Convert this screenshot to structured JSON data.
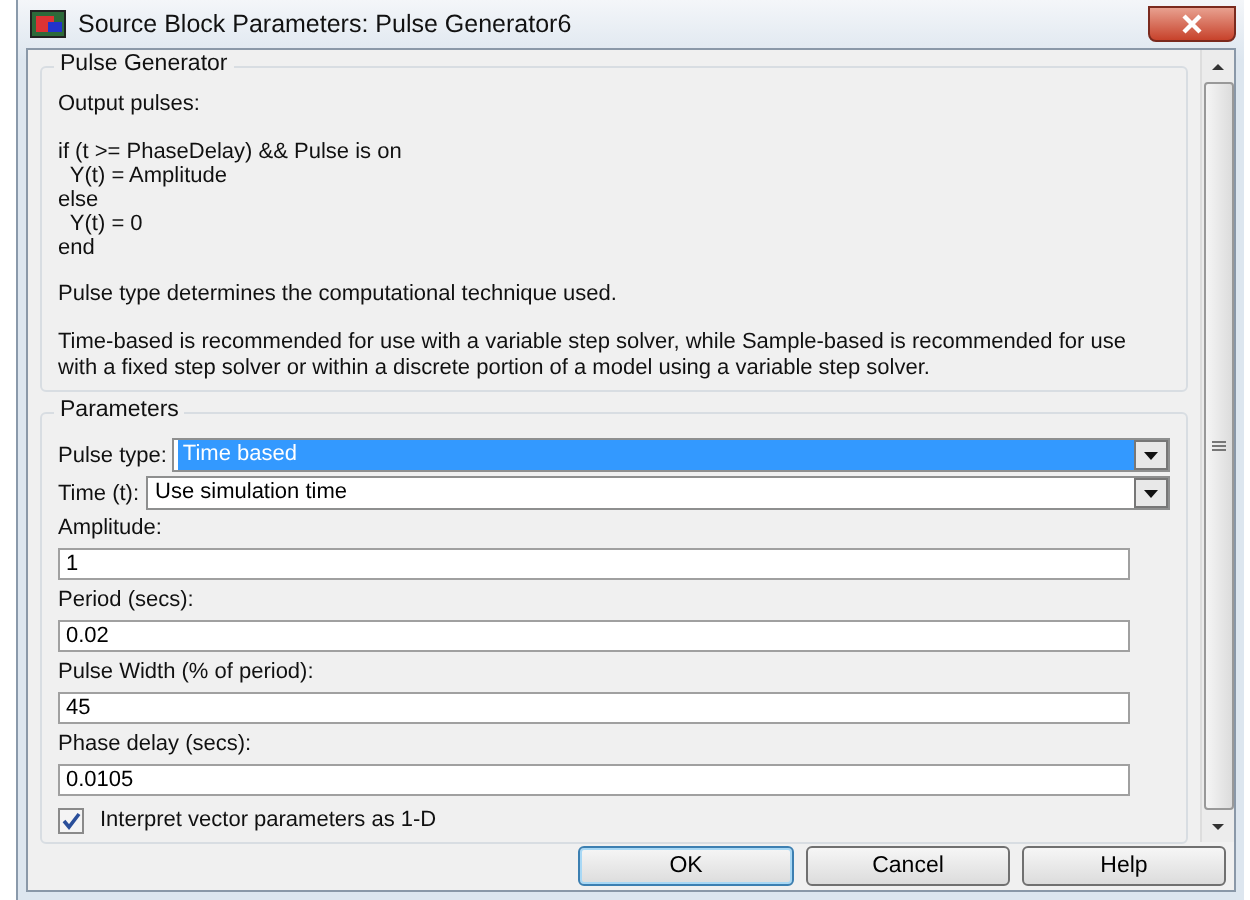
{
  "window": {
    "title": "Source Block Parameters: Pulse Generator6"
  },
  "description": {
    "title": "Pulse Generator",
    "blocks": [
      {
        "kind": "text",
        "text": "Output pulses:"
      },
      {
        "kind": "code",
        "lines": [
          "if (t >= PhaseDelay) && Pulse is on",
          "  Y(t) = Amplitude",
          "else",
          "  Y(t) = 0",
          "end"
        ]
      },
      {
        "kind": "text",
        "text": "Pulse type determines the computational technique used."
      },
      {
        "kind": "text",
        "text": "Time-based is recommended for use with a variable step solver, while Sample-based is recommended for use with a fixed step solver or within a discrete portion of a model using a variable step solver."
      }
    ]
  },
  "parameters": {
    "title": "Parameters",
    "items": [
      {
        "kind": "dropdown",
        "label": "Pulse type:",
        "value": "Time based",
        "focused": true
      },
      {
        "kind": "dropdown",
        "label": "Time (t):",
        "value": "Use simulation time",
        "focused": false
      },
      {
        "kind": "field",
        "label": "Amplitude:",
        "value": "1"
      },
      {
        "kind": "field",
        "label": "Period (secs):",
        "value": "0.02"
      },
      {
        "kind": "field",
        "label": "Pulse Width (% of period):",
        "value": "45"
      },
      {
        "kind": "field",
        "label": "Phase delay (secs):",
        "value": "0.0105"
      },
      {
        "kind": "checkbox",
        "label": "Interpret vector parameters as 1-D",
        "checked": true
      }
    ]
  },
  "buttons": [
    {
      "label": "OK",
      "default": true
    },
    {
      "label": "Cancel",
      "default": false
    },
    {
      "label": "Help",
      "default": false
    }
  ]
}
